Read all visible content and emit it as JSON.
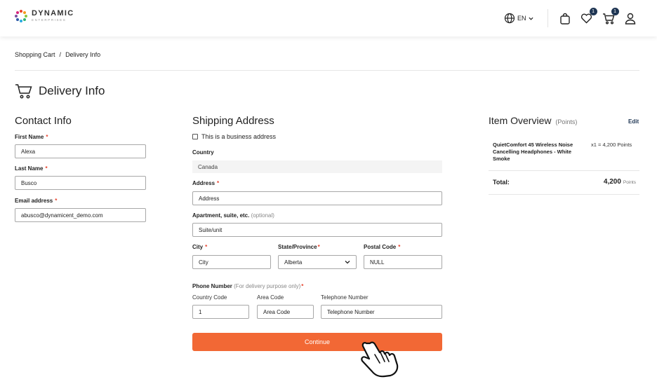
{
  "brand": {
    "name": "DYNAMIC",
    "sub": "ENTERPRISES"
  },
  "header": {
    "lang": "EN",
    "wishlist_count": "1",
    "cart_count": "1"
  },
  "breadcrumb": {
    "item1": "Shopping Cart",
    "sep": "/",
    "item2": "Delivery Info"
  },
  "page": {
    "title": "Delivery Info"
  },
  "contact": {
    "title": "Contact Info",
    "first_name_label": "First Name",
    "first_name_value": "Alexa",
    "last_name_label": "Last Name",
    "last_name_value": "Busco",
    "email_label": "Email address",
    "email_value": "abusco@dynamicent_demo.com"
  },
  "shipping": {
    "title": "Shipping Address",
    "business_label": "This is a business address",
    "country_label": "Country",
    "country_value": "Canada",
    "address_label": "Address",
    "address_placeholder": "Address",
    "apt_label": "Apartment, suite, etc.",
    "apt_optional": "(optional)",
    "apt_placeholder": "Suite/unit",
    "city_label": "City",
    "city_placeholder": "City",
    "state_label": "State/Province",
    "state_value": "Alberta",
    "postal_label": "Postal Code",
    "postal_value": "NULL",
    "phone_label": "Phone Number",
    "phone_note": "(For delivery purpose only)",
    "country_code_label": "Country Code",
    "country_code_value": "1",
    "area_code_label": "Area Code",
    "area_code_placeholder": "Area Code",
    "tel_label": "Telephone Number",
    "tel_placeholder": "Telephone Number",
    "required_mark": "*",
    "continue_label": "Continue"
  },
  "overview": {
    "title": "Item Overview",
    "points_note": "(Points)",
    "edit_label": "Edit",
    "item_name": "QuietComfort 45 Wireless Noise Cancelling Headphones - White Smoke",
    "item_qty": "x1 = 4,200 Points",
    "total_label": "Total:",
    "total_value": "4,200",
    "total_unit": "Points"
  },
  "colors": {
    "accent": "#f26835",
    "navy": "#1e3553",
    "required": "#e8432e"
  }
}
